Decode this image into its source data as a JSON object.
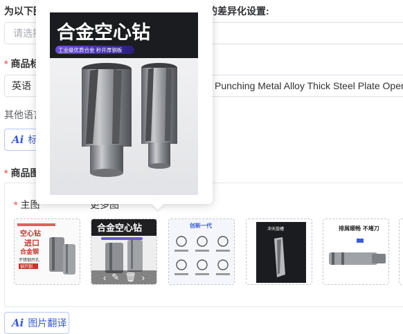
{
  "header": {
    "title_suffix": "的差异化设置:"
  },
  "select": {
    "placeholder": "请选择"
  },
  "product_title": {
    "label": "商品标",
    "language": "英语",
    "value": "Punching Metal Alloy Thick Steel Plate Open"
  },
  "other_lang": {
    "label": "其他语言"
  },
  "title_translate": {
    "label": "标题"
  },
  "product_images": {
    "label": "商品图",
    "main_label": "主图",
    "more_label": "更多图"
  },
  "popover": {
    "headline": "合金空心钻",
    "tag": "工业级优质合金 秒开厚钢板"
  },
  "thumbs": [
    {
      "name": "thumb-1",
      "lines": [
        "空心钻",
        "进口",
        "合金钢",
        "不锈钢开孔",
        "钢开割"
      ]
    },
    {
      "name": "thumb-2",
      "headline": "合金空心钻"
    },
    {
      "name": "thumb-3",
      "headline": "创新一代"
    },
    {
      "name": "thumb-4",
      "headline": "冲天旋槽"
    },
    {
      "name": "thumb-5",
      "headline": "排屑顺畅 不堵刀"
    }
  ],
  "image_translate": {
    "label": "图片翻译"
  },
  "colors": {
    "accent": "#3b5cd6",
    "required": "#f56c6c",
    "border": "#dcdfe6"
  },
  "icons": [
    "ai-icon",
    "edit-icon",
    "delete-icon",
    "chevron-left-icon",
    "chevron-right-icon"
  ]
}
